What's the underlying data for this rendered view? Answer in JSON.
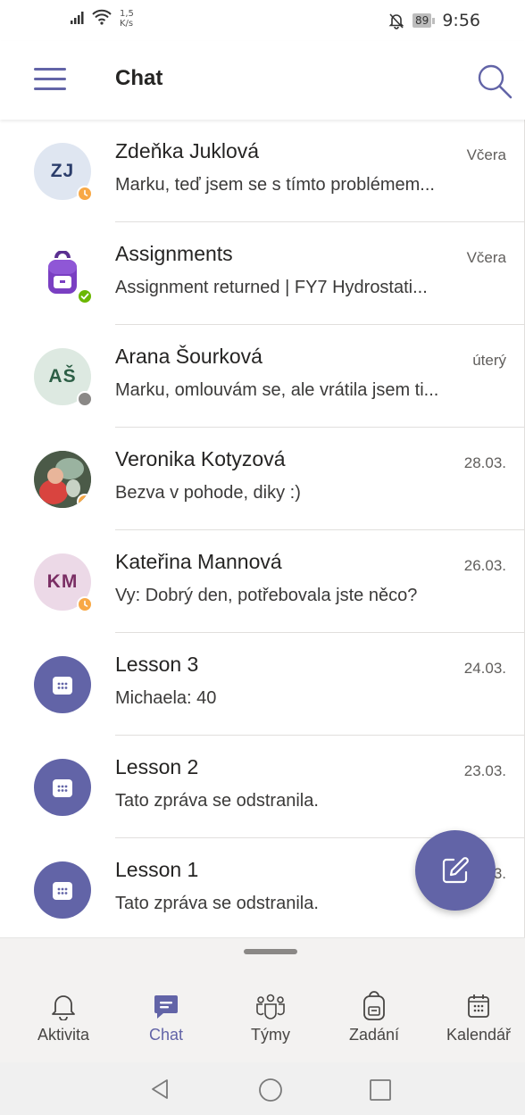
{
  "status_bar": {
    "speed_value": "1,5",
    "speed_unit": "K/s",
    "battery": "89",
    "time": "9:56"
  },
  "header": {
    "title": "Chat"
  },
  "chats": [
    {
      "initials": "ZJ",
      "name": "Zdeňka Juklová",
      "date": "Včera",
      "preview": "Marku, teď jsem se s tímto problémem...",
      "presence": "away"
    },
    {
      "initials": "",
      "name": "Assignments",
      "date": "Včera",
      "preview": "Assignment returned | FY7 Hydrostati...",
      "presence": "available"
    },
    {
      "initials": "AŠ",
      "name": "Arana Šourková",
      "date": "úterý",
      "preview": "Marku, omlouvám se, ale vrátila jsem ti...",
      "presence": "offline"
    },
    {
      "initials": "",
      "name": "Veronika Kotyzová",
      "date": "28.03.",
      "preview": "Bezva v pohode, diky :)",
      "presence": "away"
    },
    {
      "initials": "KM",
      "name": "Kateřina Mannová",
      "date": "26.03.",
      "preview": "Vy: Dobrý den, potřebovala jste něco?",
      "presence": "away"
    },
    {
      "initials": "",
      "name": "Lesson 3",
      "date": "24.03.",
      "preview": "Michaela: 40",
      "presence": ""
    },
    {
      "initials": "",
      "name": "Lesson 2",
      "date": "23.03.",
      "preview": "Tato zpráva se odstranila.",
      "presence": ""
    },
    {
      "initials": "",
      "name": "Lesson 1",
      "date": "3.",
      "preview": "Tato zpráva se odstranila.",
      "presence": ""
    }
  ],
  "bottom_nav": [
    {
      "label": "Aktivita",
      "icon": "bell-icon"
    },
    {
      "label": "Chat",
      "icon": "chat-icon",
      "active": true
    },
    {
      "label": "Týmy",
      "icon": "teams-icon"
    },
    {
      "label": "Zadání",
      "icon": "backpack-icon"
    },
    {
      "label": "Kalendář",
      "icon": "calendar-icon"
    }
  ],
  "colors": {
    "accent": "#6264a7",
    "away": "#f8a845",
    "available": "#6bb700",
    "offline": "#8a8886"
  }
}
